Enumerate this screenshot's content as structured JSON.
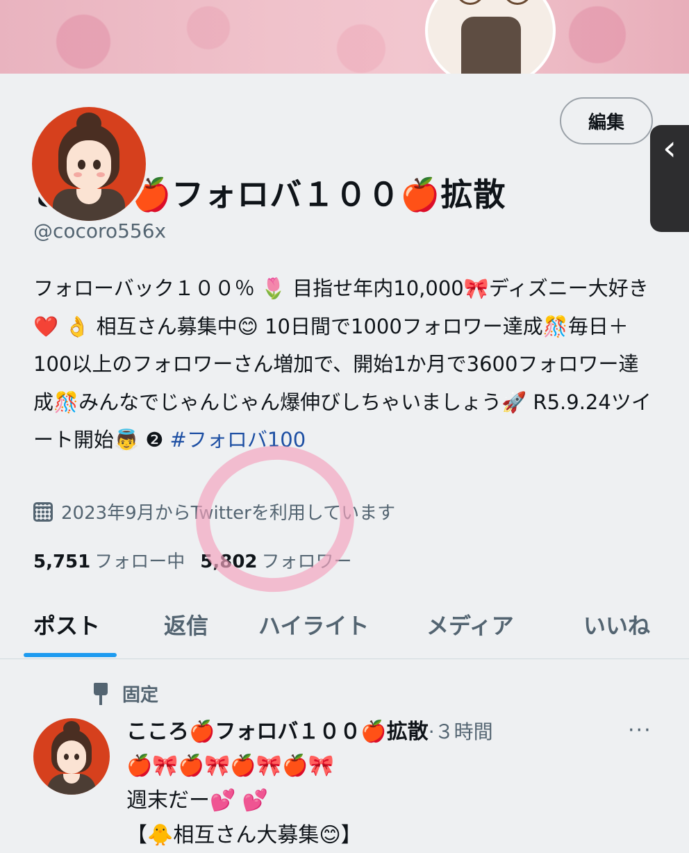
{
  "profile": {
    "display_name": "こころ🍎フォロバ１００🍎拡散",
    "handle": "@cocoro556x",
    "bio": "フォローバック１００％ 🌷 目指せ年内10,000🎀ディズニー大好き❤️ 👌 相互さん募集中😊 10日間で1000フォロワー達成🎊毎日＋100以上のフォロワーさん増加で、開始1か月で3600フォロワー達成🎊みんなでじゃんじゃん爆伸びしちゃいましょう🚀 R5.9.24ツイート開始👼 ❷ ",
    "bio_hashtag": "#フォロバ100",
    "joined": "2023年9月からTwitterを利用しています",
    "following_count": "5,751",
    "following_label": "フォロー中",
    "followers_count": "5,802",
    "followers_label": "フォロワー",
    "edit_label": "編集"
  },
  "tabs": [
    "ポスト",
    "返信",
    "ハイライト",
    "メディア",
    "いいね"
  ],
  "active_tab": "ポスト",
  "pinned_post": {
    "pinned_label": "固定",
    "author": "こころ🍎フォロバ１００🍎拡散",
    "time": "·３時間",
    "more": "···",
    "text": "🍎🎀🍎🎀🍎🎀🍎🎀\n週末だー💕 💕\n【🐥相互さん大募集😊】"
  },
  "icons": {
    "side_handle": "chevron-left-icon",
    "calendar": "calendar-icon",
    "pin": "pin-icon",
    "more": "more-horizontal-icon"
  },
  "colors": {
    "accent": "#1d9bf0",
    "avatar_bg": "#d6401d",
    "hashtag": "#1d4fa3",
    "annotation_circle": "#f3a4be"
  }
}
